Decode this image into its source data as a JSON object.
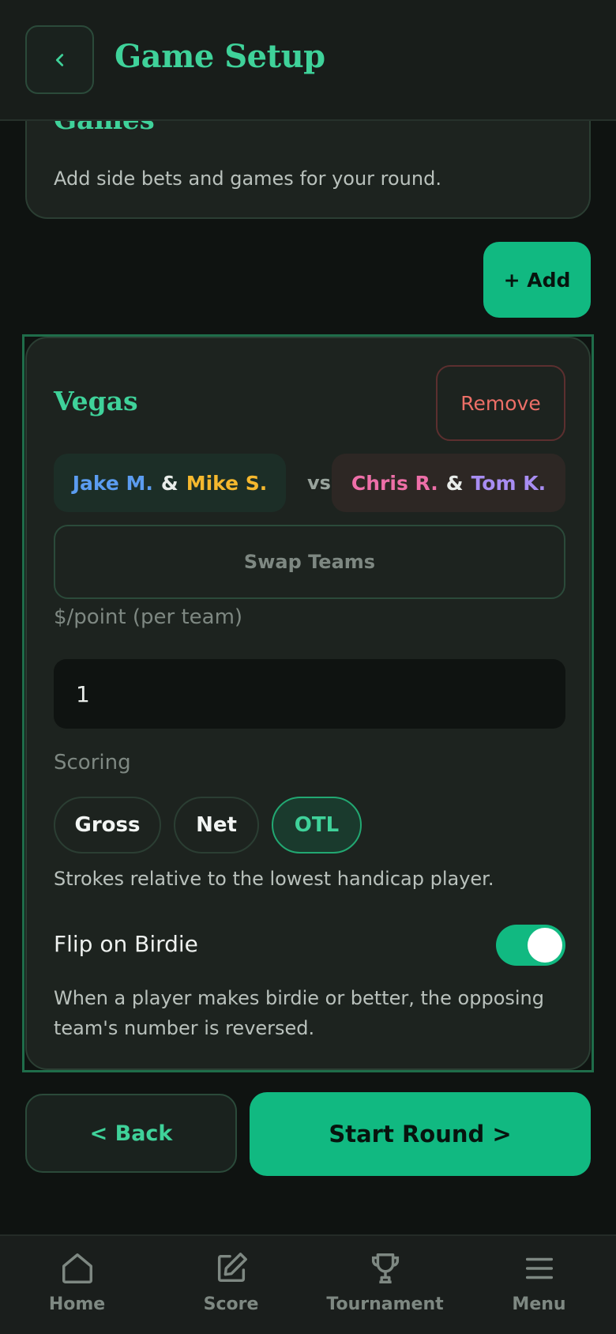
{
  "header": {
    "title": "Game Setup"
  },
  "intro": {
    "title": "Games",
    "description": "Add side bets and games for your round."
  },
  "add_button": "+ Add",
  "game": {
    "title": "Vegas",
    "remove_label": "Remove",
    "team1": {
      "player1": "Jake M.",
      "amp": "&",
      "player2": "Mike S."
    },
    "vs": "vs",
    "team2": {
      "player1": "Chris R.",
      "amp": "&",
      "player2": "Tom K."
    },
    "swap_label": "Swap Teams",
    "point_label": "$/point (per team)",
    "point_value": "1",
    "scoring_label": "Scoring",
    "scoring_options": [
      "Gross",
      "Net",
      "OTL"
    ],
    "scoring_selected": "OTL",
    "scoring_description": "Strokes relative to the lowest handicap player.",
    "flip_label": "Flip on Birdie",
    "flip_enabled": true,
    "flip_description": "When a player makes birdie or better, the opposing team's number is reversed."
  },
  "actions": {
    "back_label": "< Back",
    "start_label": "Start Round >"
  },
  "nav": {
    "items": [
      {
        "label": "Home",
        "icon": "home-icon"
      },
      {
        "label": "Score",
        "icon": "edit-icon"
      },
      {
        "label": "Tournament",
        "icon": "trophy-icon"
      },
      {
        "label": "Menu",
        "icon": "menu-icon"
      }
    ]
  },
  "colors": {
    "accent": "#11b981",
    "player_jake": "#5b9cf0",
    "player_mike": "#f5b82e",
    "player_chris": "#ee6fa8",
    "player_tom": "#a88df2",
    "danger": "#ec6f67"
  }
}
